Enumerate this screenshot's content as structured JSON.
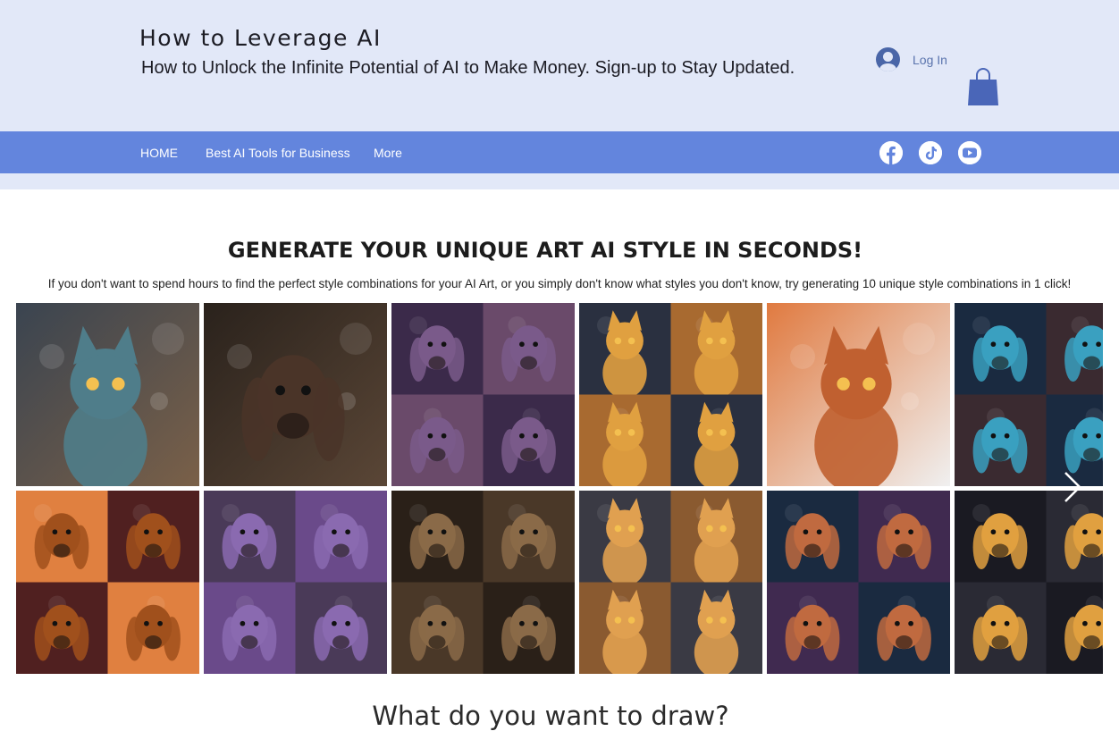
{
  "header": {
    "title": "How to Leverage AI",
    "tagline": "How to Unlock the Infinite Potential of AI to Make Money. Sign-up to Stay Updated.",
    "login_label": "Log In"
  },
  "nav": {
    "items": [
      {
        "label": "HOME"
      },
      {
        "label": "Best AI Tools for Business"
      },
      {
        "label": "More"
      }
    ],
    "social": [
      "facebook-icon",
      "tiktok-icon",
      "youtube-icon"
    ]
  },
  "main": {
    "headline": "GENERATE YOUR UNIQUE ART AI STYLE IN SECONDS!",
    "subline": "If you don't want to spend hours to find the perfect style combinations for your AI Art, or you simply don't know what styles you don't know, try generating 10 unique style combinations in 1 click!",
    "draw_prompt": "What do you want to draw?"
  },
  "gallery": {
    "tiles": [
      {
        "subject": "cat",
        "bg": [
          "#3a4450",
          "#7a6048"
        ],
        "accent": "#4f7d8a"
      },
      {
        "subject": "dog",
        "bg": [
          "#2a221c",
          "#5a4636"
        ],
        "accent": "#4a3428"
      },
      {
        "subject": "dog-grid",
        "bg": [
          "#3b2a4a",
          "#6a4a6a"
        ],
        "accent": "#7a5a8a"
      },
      {
        "subject": "cat-grid",
        "bg": [
          "#2a3040",
          "#a86a30"
        ],
        "accent": "#e0a040"
      },
      {
        "subject": "cat",
        "bg": [
          "#e07a40",
          "#f0f0f0"
        ],
        "accent": "#c06030"
      },
      {
        "subject": "dog-grid",
        "bg": [
          "#1a2a40",
          "#3a2a30"
        ],
        "accent": "#3aa0c0"
      },
      {
        "subject": "dog-grid",
        "bg": [
          "#e08040",
          "#502020"
        ],
        "accent": "#a0501c"
      },
      {
        "subject": "dog-grid",
        "bg": [
          "#4a3a58",
          "#6a4a8a"
        ],
        "accent": "#8a6ab0"
      },
      {
        "subject": "dog-grid",
        "bg": [
          "#2a2018",
          "#4a3828"
        ],
        "accent": "#8a6a48"
      },
      {
        "subject": "cat-grid",
        "bg": [
          "#3a3a44",
          "#8a5a30"
        ],
        "accent": "#e0a050"
      },
      {
        "subject": "dog-grid",
        "bg": [
          "#1a2a40",
          "#402a50"
        ],
        "accent": "#c06a40"
      },
      {
        "subject": "dog-grid",
        "bg": [
          "#1a1a22",
          "#2a2a34"
        ],
        "accent": "#e0a040"
      }
    ]
  }
}
